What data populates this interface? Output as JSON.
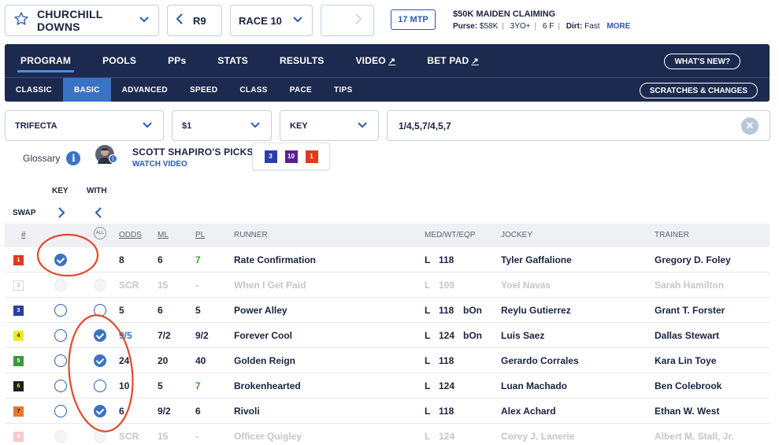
{
  "track": {
    "name": "CHURCHILL DOWNS"
  },
  "race_nav": {
    "prev_label": "R9",
    "selected": "RACE 10"
  },
  "mtp": "17 MTP",
  "race_info": {
    "title": "$50K MAIDEN CLAIMING",
    "purse_label": "Purse:",
    "purse": "$58K",
    "age": "3YO+",
    "distance": "6 F",
    "surface_label": "Dirt:",
    "surface": "Fast",
    "more": "MORE"
  },
  "main_tabs": [
    {
      "label": "PROGRAM"
    },
    {
      "label": "POOLS"
    },
    {
      "label": "PPs"
    },
    {
      "label": "STATS"
    },
    {
      "label": "RESULTS"
    },
    {
      "label": "VIDEO"
    },
    {
      "label": "BET PAD"
    }
  ],
  "whats_new": "WHAT'S NEW?",
  "sub_tabs": [
    {
      "label": "CLASSIC"
    },
    {
      "label": "BASIC"
    },
    {
      "label": "ADVANCED"
    },
    {
      "label": "SPEED"
    },
    {
      "label": "CLASS"
    },
    {
      "label": "PACE"
    },
    {
      "label": "TIPS"
    }
  ],
  "scratches": "SCRATCHES & CHANGES",
  "bet": {
    "type": "TRIFECTA",
    "amount": "$1",
    "modifier": "KEY",
    "combo": "1/4,5,7/4,5,7"
  },
  "glossary": "Glossary",
  "picks": {
    "title": "SCOTT SHAPIRO'S PICKS",
    "video": "WATCH VIDEO",
    "chips": [
      "3",
      "10",
      "1"
    ]
  },
  "labels": {
    "key": "KEY",
    "with": "WITH",
    "swap": "SWAP",
    "all": "ALL"
  },
  "columns": {
    "num": "#",
    "odds": "ODDS",
    "ml": "ML",
    "pl": "PL",
    "runner": "RUNNER",
    "med": "MED/WT/EQP",
    "jockey": "JOCKEY",
    "trainer": "TRAINER"
  },
  "colors": {
    "navy": "#1b2a4e",
    "accent": "#3a72c4",
    "annotation": "#e04a2a"
  },
  "runners": [
    {
      "num": "1",
      "pp_color": "#e03a1e",
      "pp_text": "#ffffff",
      "odds": "8",
      "ml": "6",
      "pl": "7",
      "runner": "Rate Confirmation",
      "med": "L",
      "wt": "118",
      "eqp": "",
      "jockey": "Tyler Gaffalione",
      "trainer": "Gregory D. Foley",
      "key": true,
      "with": null,
      "scratched": false,
      "pl_green": true
    },
    {
      "num": "2",
      "pp_color": "#ffffff",
      "pp_text": "#b8bcc5",
      "odds": "SCR",
      "ml": "15",
      "pl": "-",
      "runner": "When I Get Paid",
      "med": "L",
      "wt": "108",
      "eqp": "",
      "jockey": "Yoel Navas",
      "trainer": "Sarah Hamilton",
      "key": null,
      "with": null,
      "scratched": true,
      "pl_green": false
    },
    {
      "num": "3",
      "pp_color": "#2a3ea8",
      "pp_text": "#ffffff",
      "odds": "5",
      "ml": "6",
      "pl": "5",
      "runner": "Power Alley",
      "med": "L",
      "wt": "118",
      "eqp": "bOn",
      "jockey": "Reylu Gutierrez",
      "trainer": "Grant T. Forster",
      "key": false,
      "with": false,
      "scratched": false,
      "pl_green": false
    },
    {
      "num": "4",
      "pp_color": "#f2e625",
      "pp_text": "#1a2340",
      "odds": "9/5",
      "ml": "7/2",
      "pl": "9/2",
      "runner": "Forever Cool",
      "med": "L",
      "wt": "124",
      "eqp": "bOn",
      "jockey": "Luis Saez",
      "trainer": "Dallas Stewart",
      "key": false,
      "with": true,
      "scratched": false,
      "pl_green": false,
      "odds_blue": true
    },
    {
      "num": "5",
      "pp_color": "#3a9a3a",
      "pp_text": "#ffffff",
      "odds": "24",
      "ml": "20",
      "pl": "40",
      "runner": "Golden Reign",
      "med": "L",
      "wt": "118",
      "eqp": "",
      "jockey": "Gerardo Corrales",
      "trainer": "Kara Lin Toye",
      "key": false,
      "with": true,
      "scratched": false,
      "pl_green": false
    },
    {
      "num": "6",
      "pp_color": "#1f1f1f",
      "pp_text": "#f2e625",
      "odds": "10",
      "ml": "5",
      "pl": "7",
      "runner": "Brokenhearted",
      "med": "L",
      "wt": "124",
      "eqp": "",
      "jockey": "Luan Machado",
      "trainer": "Ben Colebrook",
      "key": false,
      "with": false,
      "scratched": false,
      "pl_green": true
    },
    {
      "num": "7",
      "pp_color": "#e8772a",
      "pp_text": "#1a2340",
      "odds": "6",
      "ml": "9/2",
      "pl": "6",
      "runner": "Rivoli",
      "med": "L",
      "wt": "118",
      "eqp": "",
      "jockey": "Alex Achard",
      "trainer": "Ethan W. West",
      "key": false,
      "with": true,
      "scratched": false,
      "pl_green": false
    },
    {
      "num": "8",
      "pp_color": "#f7c9cf",
      "pp_text": "#ffffff",
      "odds": "SCR",
      "ml": "15",
      "pl": "-",
      "runner": "Officer Quigley",
      "med": "L",
      "wt": "124",
      "eqp": "",
      "jockey": "Corey J. Lanerie",
      "trainer": "Albert M. Stall, Jr.",
      "key": null,
      "with": null,
      "scratched": true,
      "pl_green": false
    }
  ]
}
